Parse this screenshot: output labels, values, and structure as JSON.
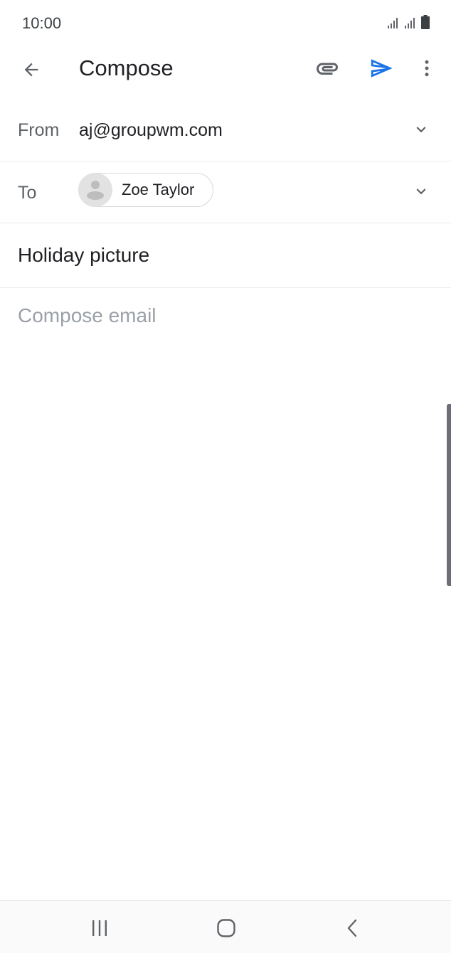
{
  "status_bar": {
    "time": "10:00"
  },
  "app_bar": {
    "title": "Compose",
    "icons": [
      "arrow-back-icon",
      "paperclip-icon",
      "send-icon",
      "more-vertical-icon"
    ],
    "send_color": "#1a73e8"
  },
  "from": {
    "label": "From",
    "value": "aj@groupwm.com"
  },
  "to": {
    "label": "To",
    "recipient": "Zoe Taylor"
  },
  "subject": {
    "value": "Holiday picture"
  },
  "body": {
    "placeholder": "Compose email"
  },
  "nav": {
    "icons": [
      "recents-icon",
      "home-icon",
      "nav-back-icon"
    ]
  }
}
